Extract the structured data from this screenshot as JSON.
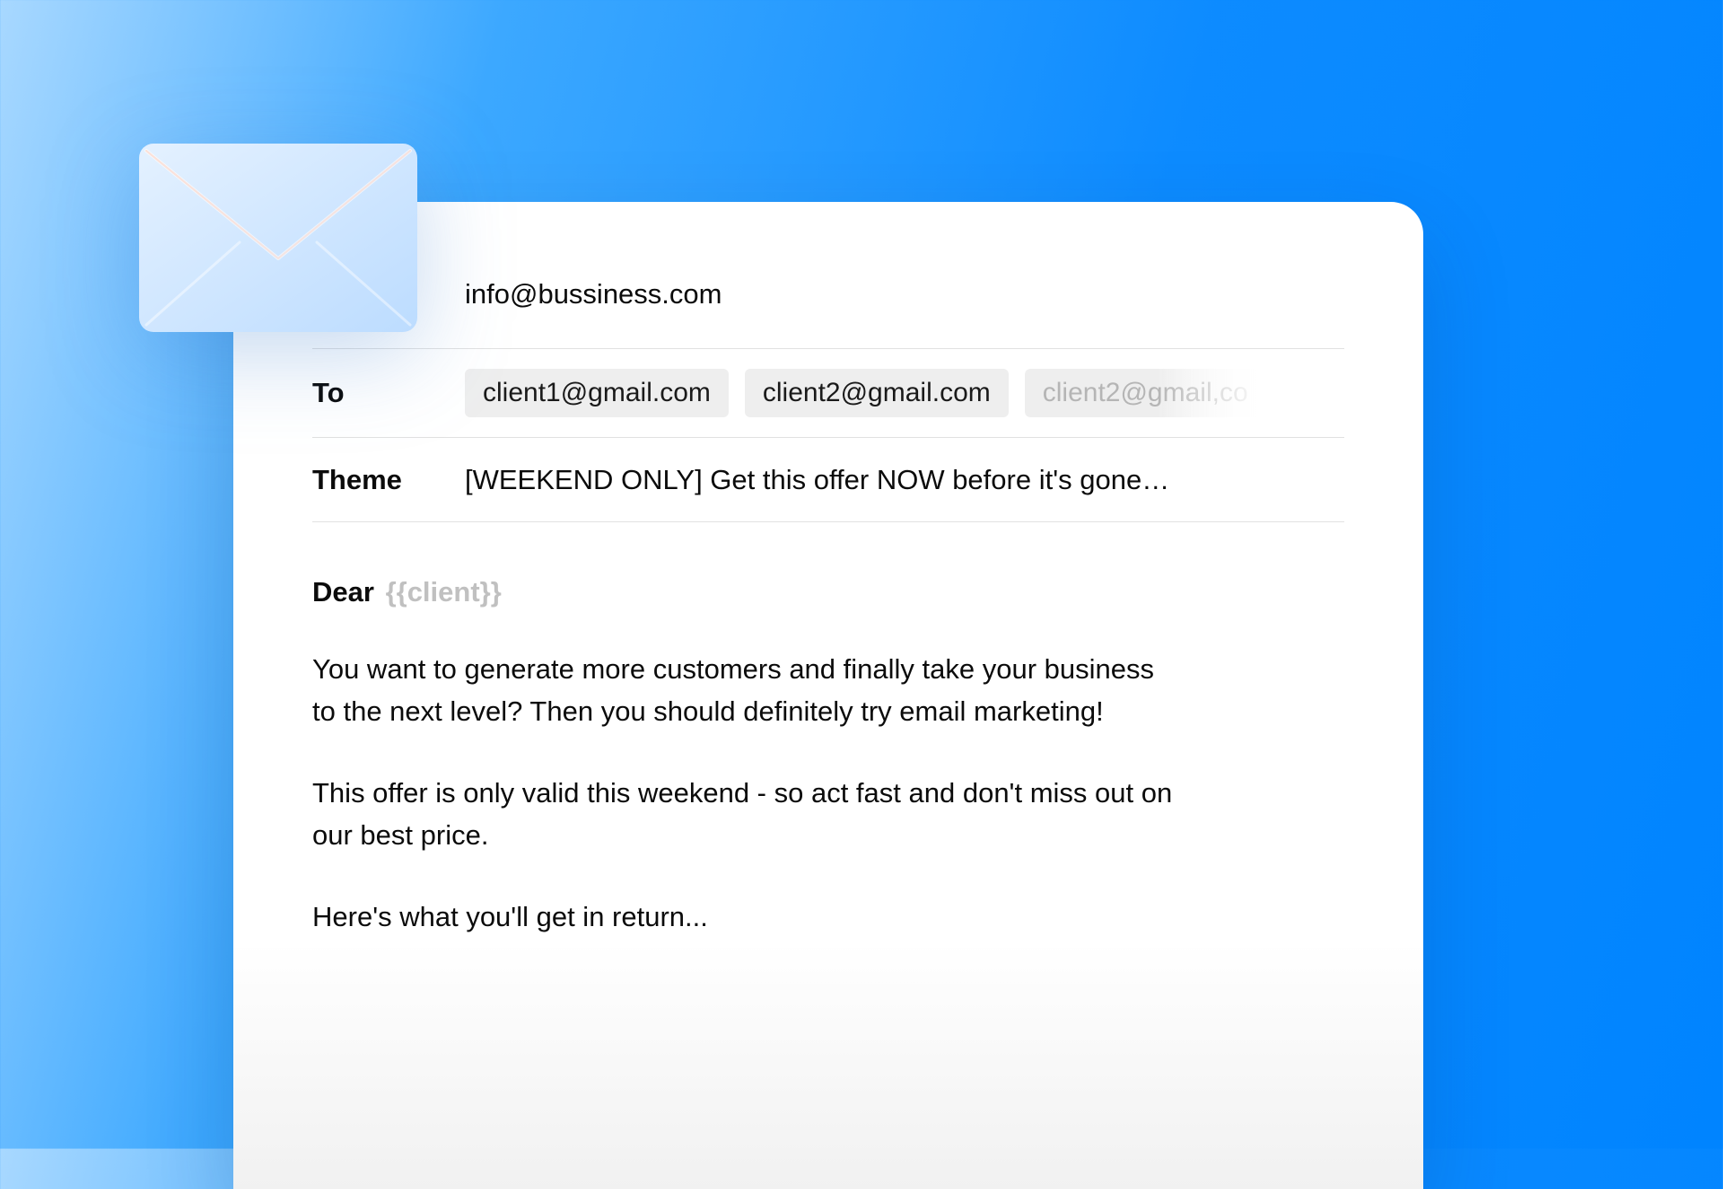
{
  "from": "info@bussiness.com",
  "labels": {
    "to": "To",
    "theme": "Theme"
  },
  "recipients": {
    "chip1": "client1@gmail.com",
    "chip2": "client2@gmail.com",
    "chip3": "client2@gmail,co"
  },
  "subject": "[WEEKEND ONLY] Get this offer NOW before it's gone…",
  "body": {
    "salutation_prefix": "Dear",
    "salutation_merge": "{{client}}",
    "para1": "You want to generate more customers and finally take your business to the next level? Then you should definitely try email marketing!",
    "para2": "This offer is only valid this weekend - so act fast and don't miss out on our best price.",
    "para3": "Here's what you'll get in return..."
  }
}
